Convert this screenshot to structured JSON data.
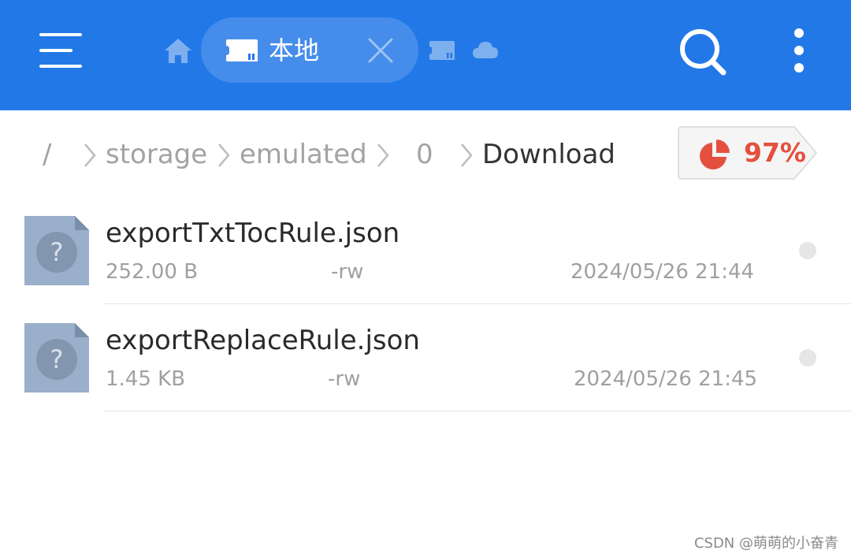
{
  "topbar": {
    "active_tab_label": "本地",
    "color": "#2378E8"
  },
  "breadcrumb": {
    "root": "/",
    "items": [
      "storage",
      "emulated",
      "0",
      "Download"
    ]
  },
  "storage_usage": {
    "percent_label": "97%",
    "color": "#E4503E"
  },
  "files": [
    {
      "name": "exportTxtTocRule.json",
      "size": "252.00 B",
      "perm": "-rw",
      "date": "2024/05/26 21:44"
    },
    {
      "name": "exportReplaceRule.json",
      "size": "1.45 KB",
      "perm": "-rw",
      "date": "2024/05/26 21:45"
    }
  ],
  "watermark": "CSDN @萌萌的小奋青"
}
